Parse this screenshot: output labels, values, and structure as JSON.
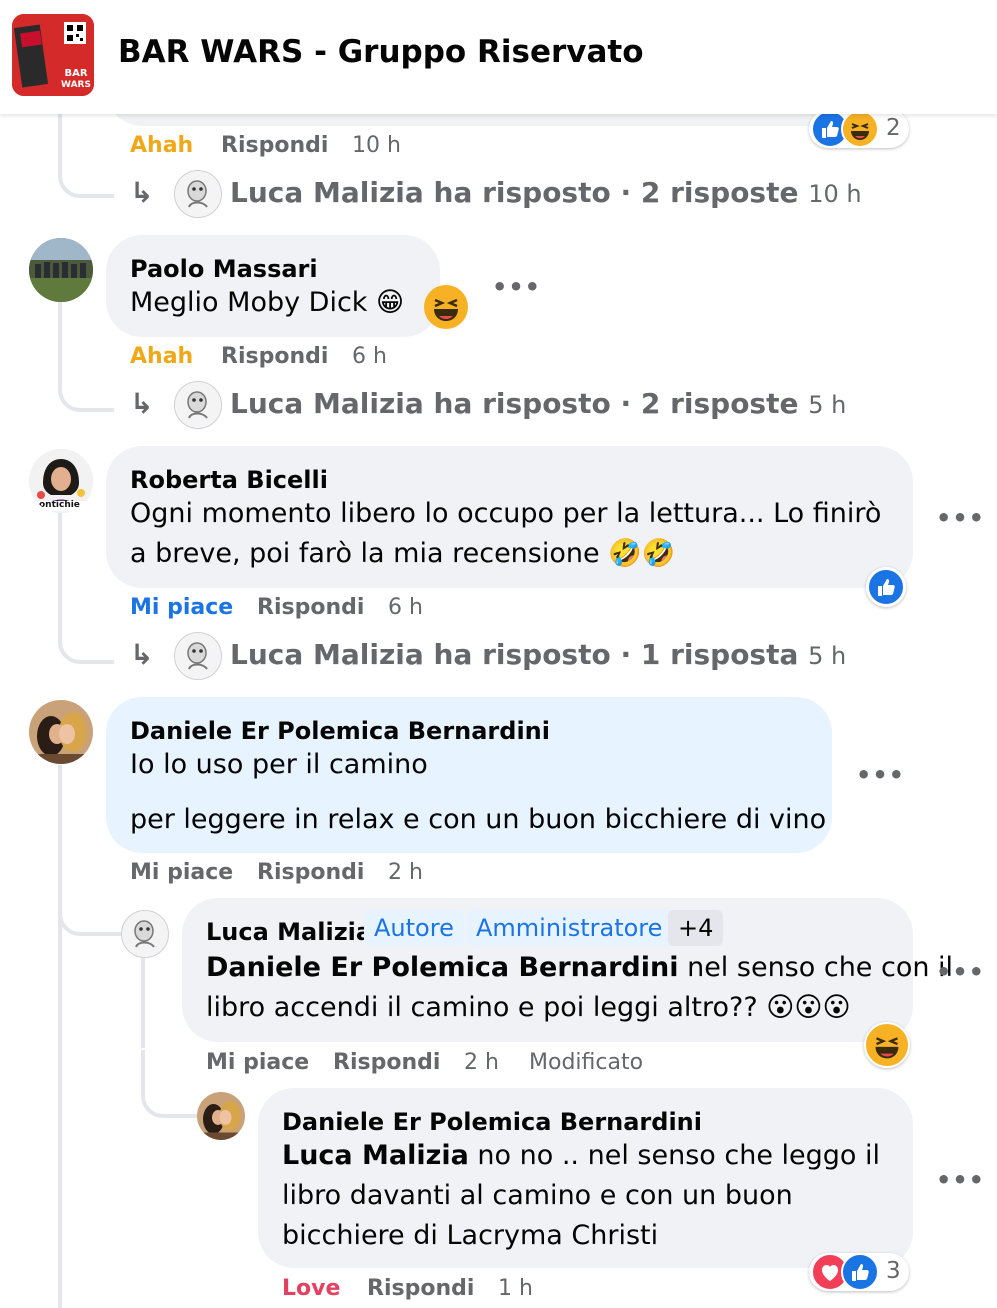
{
  "header": {
    "title": "BAR WARS - Gruppo Riservato",
    "thumb_text": "BAR WARS"
  },
  "top_fragment": {
    "reaction_action": "Ahah",
    "reply_label": "Rispondi",
    "time": "10 h",
    "reaction_count": "2",
    "reply_summary": "Luca Malizia ha risposto · 2 risposte",
    "reply_summary_time": "10 h"
  },
  "comments": [
    {
      "author": "Paolo Massari",
      "text": "Meglio Moby Dick 😁",
      "reaction_action": "Ahah",
      "reply_label": "Rispondi",
      "time": "6 h",
      "reply_summary": "Luca Malizia ha risposto · 2 risposte",
      "reply_summary_time": "5 h"
    },
    {
      "author": "Roberta Bicelli",
      "text_line1": "Ogni momento libero lo occupo per la lettura... Lo finirò",
      "text_line2": "a breve, poi farò la mia recensione 🤣🤣",
      "avatar_caption": "ontichie",
      "reaction_action": "Mi piace",
      "reply_label": "Rispondi",
      "time": "6 h",
      "reply_summary": "Luca Malizia ha risposto · 1 risposta",
      "reply_summary_time": "5 h"
    },
    {
      "author": "Daniele Er Polemica Bernardini",
      "text_line1": "Io lo uso per il camino",
      "text_line2": "per leggere in relax e con un buon bicchiere di vino",
      "reaction_action": "Mi piace",
      "reply_label": "Rispondi",
      "time": "2 h"
    }
  ],
  "replies": [
    {
      "author": "Luca Malizia",
      "badges": [
        "Autore",
        "Amministratore",
        "+4"
      ],
      "mention": "Daniele Er Polemica Bernardini",
      "text_line1": " nel senso che con il",
      "text_line2": "libro accendi il camino e poi leggi altro?? 😮😮😮",
      "reaction_action": "Mi piace",
      "reply_label": "Rispondi",
      "time": "2 h",
      "edited": "Modificato"
    },
    {
      "author": "Daniele Er Polemica Bernardini",
      "mention": "Luca Malizia",
      "text_line1": " no no .. nel senso che leggo il",
      "text_line2": "libro davanti al camino e con un buon",
      "text_line3": "bicchiere di Lacryma Christi",
      "reaction_action": "Love",
      "reply_label": "Rispondi",
      "time": "1 h",
      "reaction_count": "3"
    }
  ],
  "colors": {
    "link_blue": "#1b74e4",
    "haha": "#f0a818",
    "love": "#e4405f",
    "meta": "#65676b"
  }
}
